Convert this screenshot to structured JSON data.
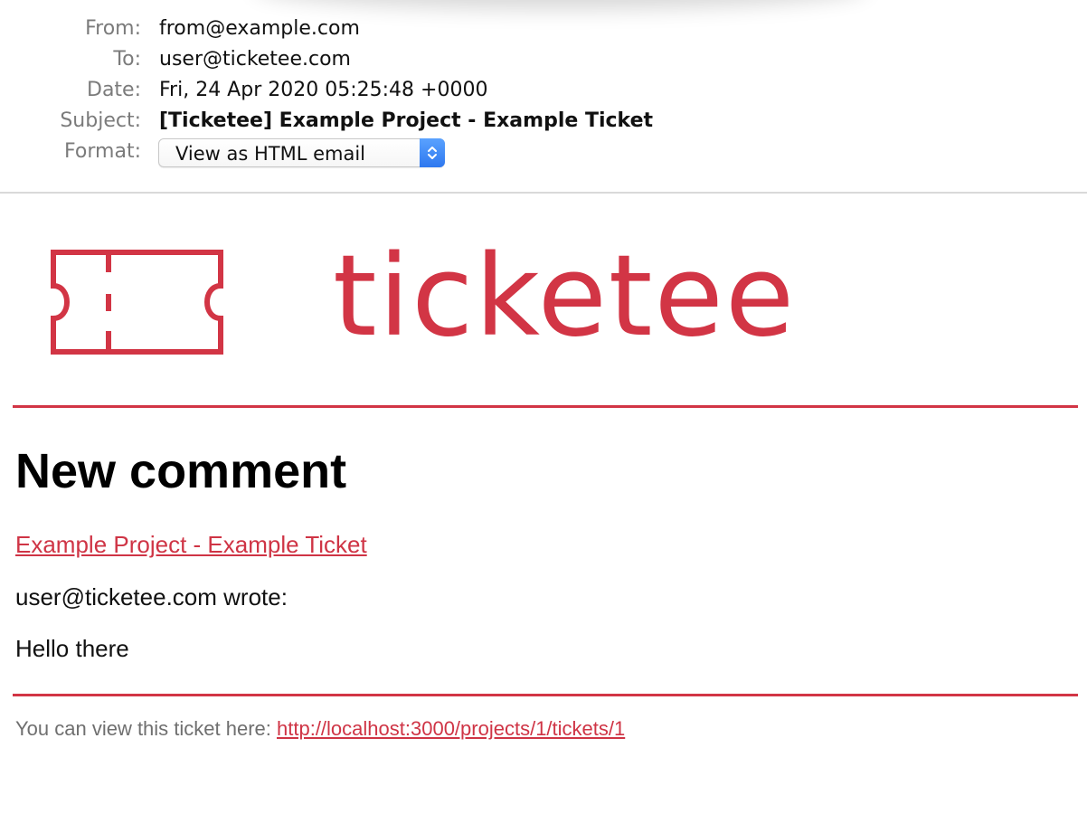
{
  "header": {
    "from_label": "From:",
    "from_value": "from@example.com",
    "to_label": "To:",
    "to_value": "user@ticketee.com",
    "date_label": "Date:",
    "date_value": "Fri, 24 Apr 2020 05:25:48 +0000",
    "subject_label": "Subject:",
    "subject_value": "[Ticketee] Example Project - Example Ticket",
    "format_label": "Format:",
    "format_selected": "View as HTML email"
  },
  "brand": {
    "name": "ticketee",
    "color": "#d23545",
    "icon": "ticket-icon"
  },
  "email": {
    "title": "New comment",
    "ticket_link_text": "Example Project - Example Ticket",
    "author_line": "user@ticketee.com wrote:",
    "comment_body": "Hello there",
    "footer_prefix": "You can view this ticket here: ",
    "footer_link": "http://localhost:3000/projects/1/tickets/1"
  }
}
